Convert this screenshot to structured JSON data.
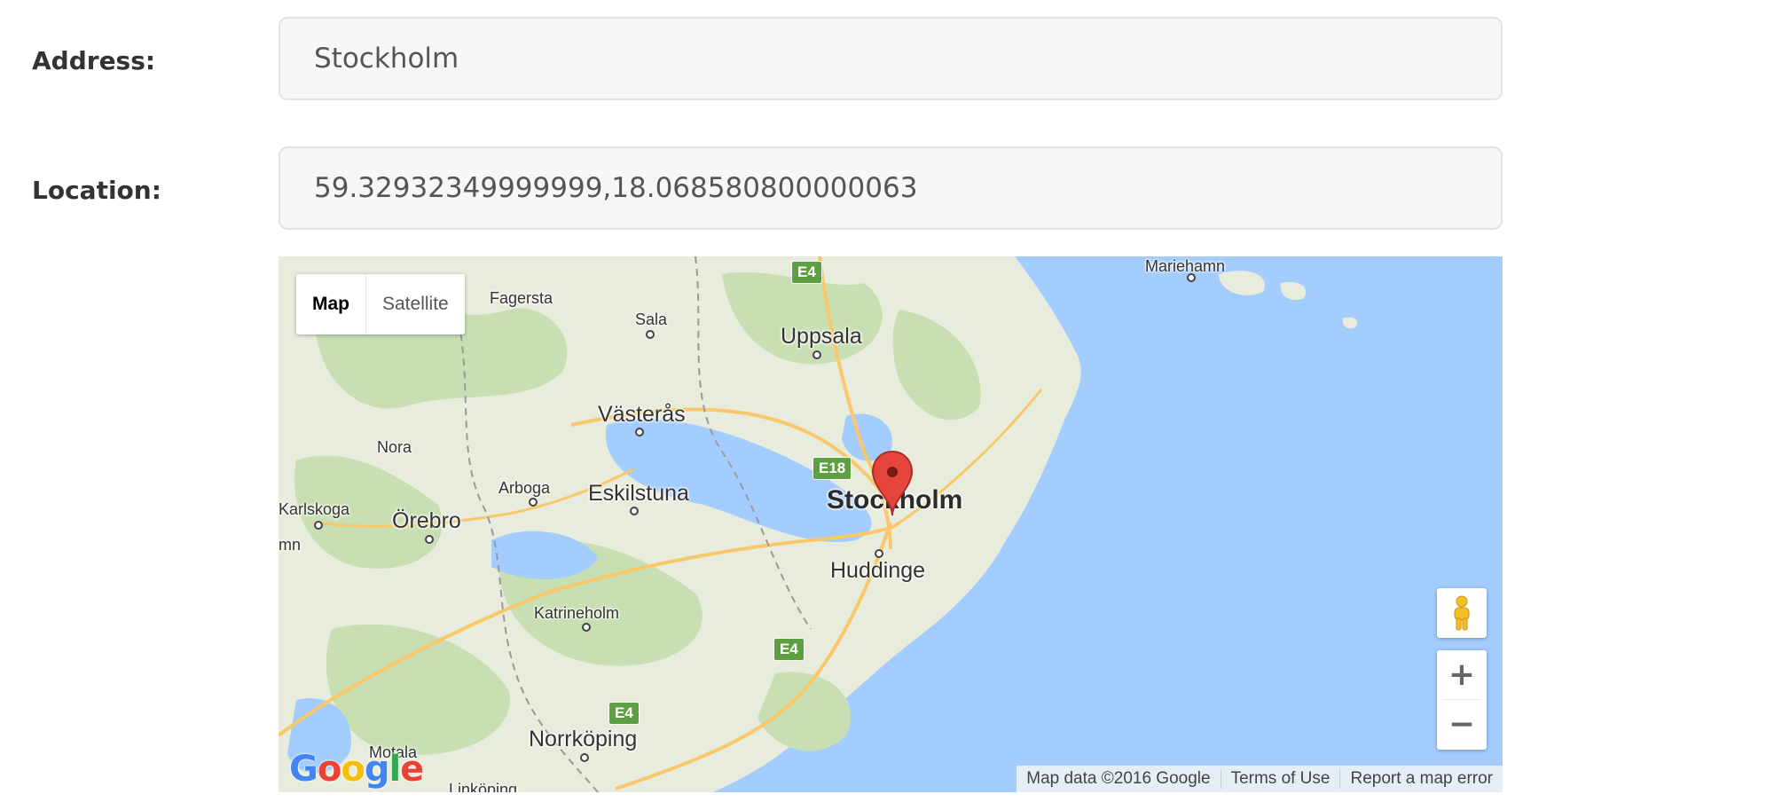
{
  "form": {
    "address_label": "Address:",
    "address_value": "Stockholm",
    "location_label": "Location:",
    "location_value": "59.32932349999999,18.068580800000063"
  },
  "map": {
    "type_controls": [
      "Map",
      "Satellite"
    ],
    "active_type": "Map",
    "marker_city": "Stockholm",
    "places": {
      "mariehamn": "Mariehamn",
      "fagersta": "Fagersta",
      "sala": "Sala",
      "uppsala": "Uppsala",
      "vasteras": "Västerås",
      "nora": "Nora",
      "arboga": "Arboga",
      "eskilstuna": "Eskilstuna",
      "karlskoga": "Karlskoga",
      "orebro": "Örebro",
      "mn": "mn",
      "stockholm": "Stockholm",
      "huddinge": "Huddinge",
      "katrineholm": "Katrineholm",
      "norrkoping": "Norrköping",
      "motala": "Motala",
      "linkoping": "Linköping"
    },
    "road_shields": [
      "E4",
      "E18",
      "E4",
      "E4"
    ],
    "zoom_in": "+",
    "zoom_out": "−",
    "logo": "Google",
    "attribution": [
      "Map data ©2016 Google",
      "Terms of Use",
      "Report a map error"
    ],
    "colors": {
      "water": "#a3ccff",
      "land": "#e8ecdc",
      "forest": "#c8dfb3",
      "road": "#f9c86a",
      "shield": "#5e9f44",
      "marker": "#e5453a"
    }
  }
}
